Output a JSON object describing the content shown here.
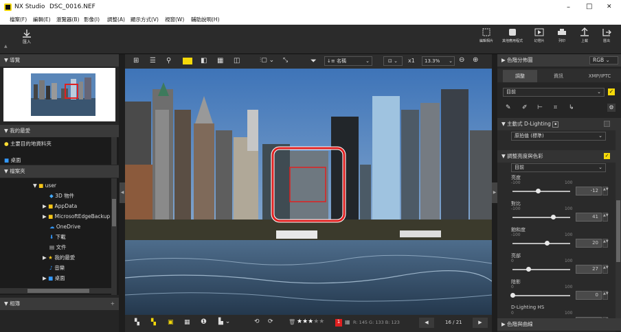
{
  "app": {
    "name": "NX Studio",
    "file": "DSC_0016.NEF"
  },
  "window_controls": {
    "min": "–",
    "max": "□",
    "close": "✕"
  },
  "menu": [
    "檔案(F)",
    "編輯(E)",
    "瀏覽器(B)",
    "影像(I)",
    "調整(A)",
    "顯示方式(V)",
    "視窗(W)",
    "輔助說明(H)"
  ],
  "toolbar": {
    "import_label": "匯入",
    "right": [
      {
        "label": "編輯相片",
        "icon": "edit-photo-icon"
      },
      {
        "label": "其他應用程式",
        "icon": "app-icon"
      },
      {
        "label": "幻燈片",
        "icon": "slideshow-icon"
      },
      {
        "label": "列印",
        "icon": "print-icon"
      },
      {
        "label": "上載",
        "icon": "upload-icon"
      },
      {
        "label": "匯出",
        "icon": "export-icon"
      }
    ]
  },
  "left": {
    "navigator": "導覽",
    "favorites": "我的最愛",
    "fav_items": [
      "主要目的地資料夾",
      "桌面"
    ],
    "folders": "檔案夾",
    "tree": [
      {
        "label": "user",
        "depth": 0
      },
      {
        "label": "3D 物件",
        "depth": 1
      },
      {
        "label": "AppData",
        "depth": 1
      },
      {
        "label": "MicrosoftEdgeBackup",
        "depth": 1
      },
      {
        "label": "OneDrive",
        "depth": 1
      },
      {
        "label": "下載",
        "depth": 1
      },
      {
        "label": "文件",
        "depth": 1
      },
      {
        "label": "我的最愛",
        "depth": 1
      },
      {
        "label": "音樂",
        "depth": 1
      },
      {
        "label": "桌面",
        "depth": 1
      }
    ],
    "albums": "相簿"
  },
  "viewer_toolbar": {
    "sort": "名稱",
    "zoom_mode": "x1",
    "zoom": "13.3%"
  },
  "status": {
    "rgb": "R: 145 G: 133 B: 123",
    "page": "16 / 21",
    "flag": "1"
  },
  "right": {
    "histogram": "色階分佈圖",
    "rgb_mode": "RGB",
    "tabs": [
      "調整",
      "資訊",
      "XMP/IPTC"
    ],
    "preset": "目前",
    "adl_title": "主動式 D-Lighting",
    "adl_value": "原拍值 (標準)",
    "bc_title": "調整亮度與色彩",
    "bc_preset": "目前",
    "sliders": [
      {
        "label": "亮度",
        "min": "-100",
        "max": "100",
        "value": "-12",
        "pos": 0.44
      },
      {
        "label": "對比",
        "min": "-100",
        "max": "100",
        "value": "41",
        "pos": 0.7
      },
      {
        "label": "飽和度",
        "min": "-100",
        "max": "100",
        "value": "20",
        "pos": 0.6
      },
      {
        "label": "亮部",
        "min": "0",
        "max": "100",
        "value": "27",
        "pos": 0.27
      },
      {
        "label": "陰影",
        "min": "0",
        "max": "100",
        "value": "0",
        "pos": 0.0
      },
      {
        "label": "D-Lighting HS",
        "min": "0",
        "max": "100",
        "value": "41",
        "pos": 0.41
      }
    ],
    "curves": "色階與曲線"
  },
  "colors": {
    "accent": "#f5d90a",
    "red": "#e02020"
  }
}
